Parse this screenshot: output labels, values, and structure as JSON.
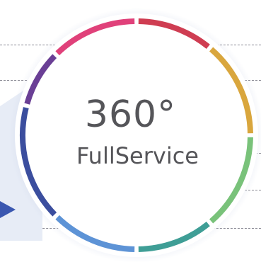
{
  "badge": {
    "value": "360°",
    "subtitle": "FullService"
  },
  "colors": {
    "ring_segments": [
      "#e0417a",
      "#cf3d52",
      "#d9a63d",
      "#79c27a",
      "#3f9e96",
      "#5d93d6",
      "#3b4e9e",
      "#6a3f95"
    ],
    "text": "#555559",
    "pointer": "#3a57b0",
    "dashes": "#8a8a94"
  }
}
